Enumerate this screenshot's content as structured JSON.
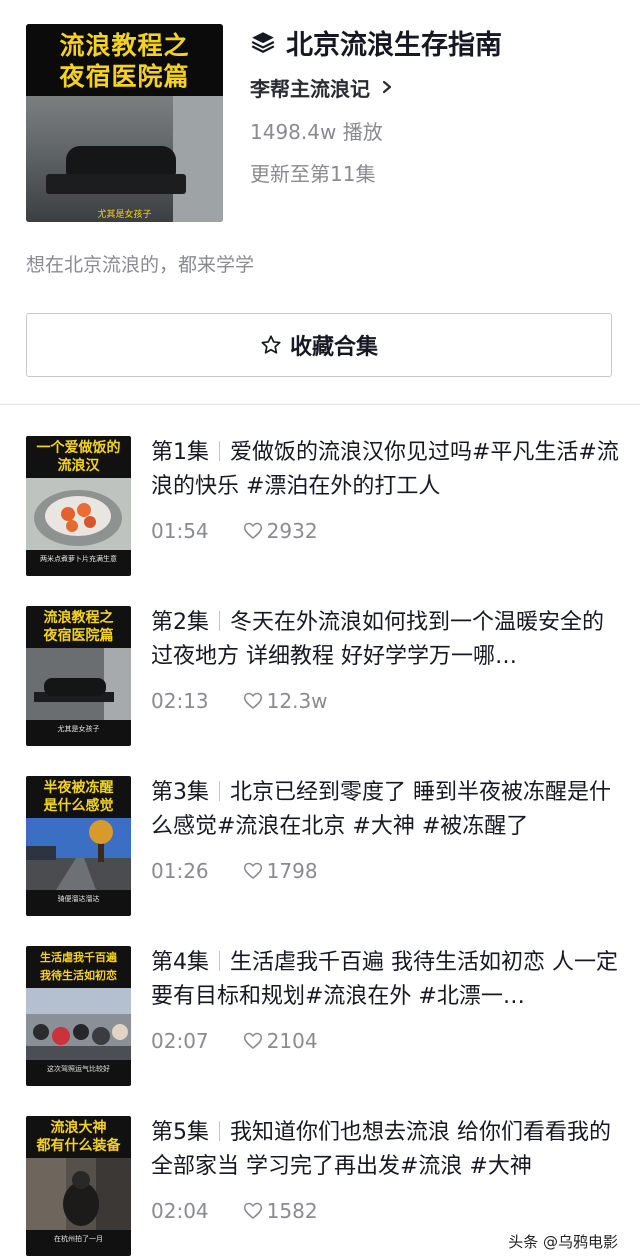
{
  "header": {
    "cover": {
      "title_line1": "流浪教程之",
      "title_line2": "夜宿医院篇",
      "caption": "尤其是女孩子"
    },
    "collection_icon": "layers-icon",
    "collection_title": "北京流浪生存指南",
    "author_name": "李帮主流浪记",
    "play_count": "1498.4w 播放",
    "updated_to": "更新至第11集",
    "description": "想在北京流浪的，都来学学"
  },
  "favorite_button": {
    "icon": "star-icon",
    "label": "收藏合集"
  },
  "episodes": [
    {
      "episode": "第1集",
      "title": "爱做饭的流浪汉你见过吗#平凡生活#流浪的快乐 #漂泊在外的打工人",
      "duration": "01:54",
      "likes": "2932",
      "thumb_title_1": "一个爱做饭的",
      "thumb_title_2": "流浪汉",
      "thumb_caption": "两米点煮萝卜片充满生意"
    },
    {
      "episode": "第2集",
      "title": "冬天在外流浪如何找到一个温暖安全的过夜地方 详细教程 好好学学万一哪…",
      "duration": "02:13",
      "likes": "12.3w",
      "thumb_title_1": "流浪教程之",
      "thumb_title_2": "夜宿医院篇",
      "thumb_caption": "尤其是女孩子"
    },
    {
      "episode": "第3集",
      "title": "北京已经到零度了 睡到半夜被冻醒是什么感觉#流浪在北京 #大神 #被冻醒了",
      "duration": "01:26",
      "likes": "1798",
      "thumb_title_1": "半夜被冻醒",
      "thumb_title_2": "是什么感觉",
      "thumb_caption": "骑便溜达溜达"
    },
    {
      "episode": "第4集",
      "title": "生活虐我千百遍 我待生活如初恋 人一定要有目标和规划#流浪在外 #北漂一…",
      "duration": "02:07",
      "likes": "2104",
      "thumb_title_1": "生活虐我千百遍",
      "thumb_title_2": "我待生活如初恋",
      "thumb_caption": "这次驾照运气比较好"
    },
    {
      "episode": "第5集",
      "title": "我知道你们也想去流浪 给你们看看我的全部家当 学习完了再出发#流浪 #大神",
      "duration": "02:04",
      "likes": "1582",
      "thumb_title_1": "流浪大神",
      "thumb_title_2": "都有什么装备",
      "thumb_caption": "在杭州拍了一月"
    }
  ],
  "watermark": "头条 @乌鸦电影",
  "colors": {
    "accent_yellow": "#f5d21f",
    "text_primary": "#161823",
    "text_secondary": "#8a8b91"
  }
}
